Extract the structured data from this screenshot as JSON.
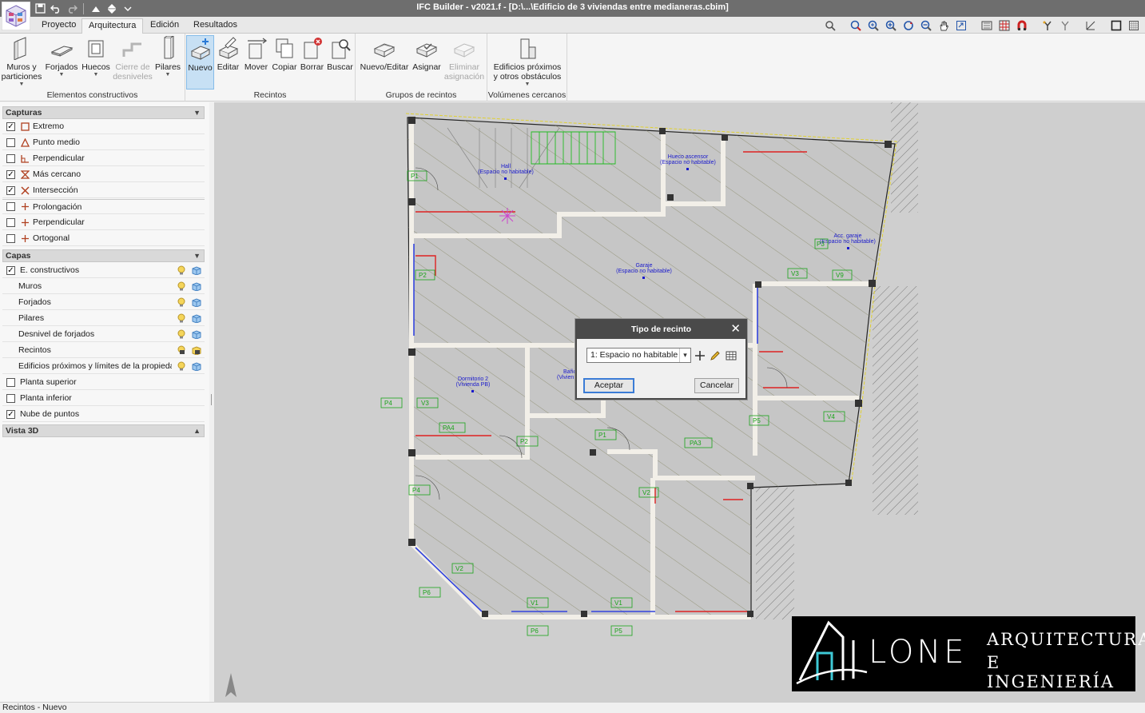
{
  "titlebar": {
    "title": "IFC Builder - v2021.f - [D:\\...\\Edificio de 3 viviendas entre medianeras.cbim]"
  },
  "tabs": [
    {
      "label": "Proyecto"
    },
    {
      "label": "Arquitectura",
      "active": true
    },
    {
      "label": "Edición"
    },
    {
      "label": "Resultados"
    }
  ],
  "ribbon": {
    "groups": [
      {
        "label": "Elementos constructivos",
        "buttons": [
          {
            "label": "Muros y particiones",
            "icon": "wall-icon"
          },
          {
            "label": "Forjados",
            "icon": "slab-icon"
          },
          {
            "label": "Huecos",
            "icon": "opening-icon"
          },
          {
            "label": "Cierre de desniveles",
            "icon": "level-closure-icon",
            "disabled": true
          },
          {
            "label": "Pilares",
            "icon": "column-icon"
          }
        ]
      },
      {
        "label": "Recintos",
        "buttons": [
          {
            "label": "Nuevo",
            "icon": "new-room-icon",
            "selected": true
          },
          {
            "label": "Editar",
            "icon": "edit-room-icon"
          },
          {
            "label": "Mover",
            "icon": "move-room-icon"
          },
          {
            "label": "Copiar",
            "icon": "copy-room-icon"
          },
          {
            "label": "Borrar",
            "icon": "delete-room-icon"
          },
          {
            "label": "Buscar",
            "icon": "search-room-icon"
          }
        ]
      },
      {
        "label": "Grupos de recintos",
        "buttons": [
          {
            "label": "Nuevo/Editar",
            "icon": "group-edit-icon"
          },
          {
            "label": "Asignar",
            "icon": "group-assign-icon"
          },
          {
            "label": "Eliminar asignación",
            "icon": "group-unassign-icon",
            "disabled": true
          }
        ]
      },
      {
        "label": "Volúmenes cercanos",
        "buttons": [
          {
            "label": "Edificios próximos y otros obstáculos",
            "icon": "nearby-buildings-icon"
          }
        ]
      }
    ]
  },
  "panel": {
    "captures_title": "Capturas",
    "captures": [
      {
        "label": "Extremo",
        "checked": true,
        "icon": "endpoint-snap-icon"
      },
      {
        "label": "Punto medio",
        "checked": false,
        "icon": "midpoint-snap-icon"
      },
      {
        "label": "Perpendicular",
        "checked": false,
        "icon": "perpendicular-snap-icon"
      },
      {
        "label": "Más cercano",
        "checked": true,
        "icon": "nearest-snap-icon"
      },
      {
        "label": "Intersección",
        "checked": true,
        "icon": "intersection-snap-icon"
      },
      {
        "label": "Prolongación",
        "checked": false,
        "icon": "extension-snap-icon"
      },
      {
        "label": "Perpendicular",
        "checked": false,
        "icon": "perpendicular-track-icon"
      },
      {
        "label": "Ortogonal",
        "checked": false,
        "icon": "orthogonal-snap-icon"
      }
    ],
    "layers_title": "Capas",
    "layers": [
      {
        "label": "E. constructivos",
        "checkbox": true,
        "checked": true,
        "indent": false,
        "locked": false
      },
      {
        "label": "Muros",
        "checkbox": false,
        "indent": true,
        "locked": false
      },
      {
        "label": "Forjados",
        "checkbox": false,
        "indent": true,
        "locked": false
      },
      {
        "label": "Pilares",
        "checkbox": false,
        "indent": true,
        "locked": false
      },
      {
        "label": "Desnivel de forjados",
        "checkbox": false,
        "indent": true,
        "locked": false
      },
      {
        "label": "Recintos",
        "checkbox": false,
        "indent": true,
        "locked": true
      },
      {
        "label": "Edificios próximos y límites de la propiedad",
        "checkbox": false,
        "indent": true,
        "locked": false
      },
      {
        "label": "Planta superior",
        "checkbox": true,
        "checked": false,
        "indent": false,
        "noicons": true
      },
      {
        "label": "Planta inferior",
        "checkbox": true,
        "checked": false,
        "indent": false,
        "noicons": true
      },
      {
        "label": "Nube de puntos",
        "checkbox": true,
        "checked": true,
        "indent": false,
        "noicons": true
      }
    ],
    "view3d_title": "Vista 3D"
  },
  "plan": {
    "rooms": [
      {
        "name": "Hall",
        "sub": "(Espacio no habitable)"
      },
      {
        "name": "Hueco ascensor",
        "sub": "(Espacio no habitable)"
      },
      {
        "name": "Garaje",
        "sub": "(Espacio no habitable)"
      },
      {
        "name": "Acc. garaje",
        "sub": "(Espacio no habitable)"
      },
      {
        "name": "Dormitorio 2",
        "sub": "(Vivienda PB)"
      },
      {
        "name": "Baño",
        "sub": "(Vivien"
      }
    ],
    "tags": [
      "P1",
      "P2",
      "V3",
      "V9",
      "P3",
      "V3",
      "P4",
      "PA4",
      "P2",
      "P1",
      "PA3",
      "V4",
      "P5",
      "P4",
      "V2",
      "P6",
      "V1",
      "V1",
      "P6",
      "P5"
    ]
  },
  "dialog": {
    "title": "Tipo de recinto",
    "select_value": "1: Espacio no habitable",
    "accept_label": "Aceptar",
    "cancel_label": "Cancelar"
  },
  "watermark": {
    "brand": "LONE",
    "line1": "ARQUITECTURA",
    "line2": "E INGENIERÍA"
  },
  "statusbar": {
    "text": "Recintos - Nuevo"
  },
  "colors": {
    "selected_button": "#c7e0f4",
    "titlebar": "#6e6e6e",
    "room_label": "#1a1acc",
    "tag": "#19a319"
  }
}
